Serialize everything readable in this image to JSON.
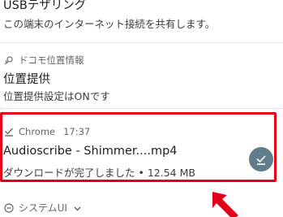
{
  "tethering": {
    "title": "USBテザリング",
    "body": "この端末のインターネット接続を共有します。"
  },
  "location": {
    "app_name": "ドコモ位置情報",
    "title": "位置提供",
    "body": "位置提供設定はONです"
  },
  "download": {
    "app_name": "Chrome",
    "time": "17:37",
    "title": "Audioscribe - Shimmer....mp4",
    "status": "ダウンロードが完了しました",
    "size": "• 12.54 MB"
  },
  "system": {
    "app_name": "システムUI"
  },
  "colors": {
    "highlight": "#e3001b",
    "action_button": "#607d8b",
    "arrow": "#e3001b"
  }
}
